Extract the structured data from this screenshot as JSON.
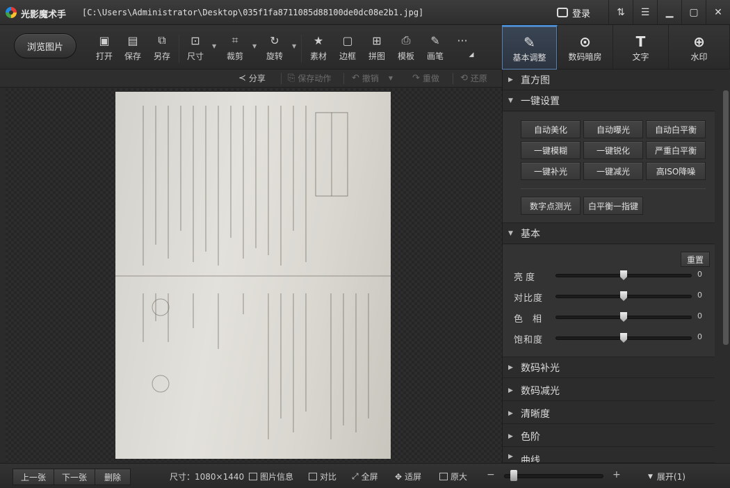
{
  "titlebar": {
    "app_name": "光影魔术手",
    "file_path": "[C:\\Users\\Administrator\\Desktop\\035f1fa8711085d88100de0dc08e2b1.jpg]",
    "login_label": "登录",
    "icons": [
      "user-icon",
      "transfer-icon",
      "menu-icon",
      "maximize-icon",
      "close-icon"
    ]
  },
  "toolbar": {
    "browse_label": "浏览图片",
    "tools": [
      {
        "key": "open",
        "label": "打开",
        "icon": "open-icon"
      },
      {
        "key": "save",
        "label": "保存",
        "icon": "save-icon"
      },
      {
        "key": "saveas",
        "label": "另存",
        "icon": "save-as-icon"
      },
      {
        "key": "size",
        "label": "尺寸",
        "icon": "size-icon"
      },
      {
        "key": "crop",
        "label": "裁剪",
        "icon": "crop-icon"
      },
      {
        "key": "rotate",
        "label": "旋转",
        "icon": "rotate-icon"
      },
      {
        "key": "material",
        "label": "素材",
        "icon": "material-icon"
      },
      {
        "key": "border",
        "label": "边框",
        "icon": "border-icon"
      },
      {
        "key": "collage",
        "label": "拼图",
        "icon": "collage-icon"
      },
      {
        "key": "template",
        "label": "模板",
        "icon": "template-icon"
      },
      {
        "key": "brush",
        "label": "画笔",
        "icon": "brush-icon"
      }
    ],
    "more_glyph": "···"
  },
  "tabs": [
    {
      "label": "基本调整",
      "icon": "basic-adjust-icon",
      "active": true
    },
    {
      "label": "数码暗房",
      "icon": "darkroom-icon",
      "active": false
    },
    {
      "label": "文字",
      "icon": "text-icon",
      "active": false
    },
    {
      "label": "水印",
      "icon": "watermark-icon",
      "active": false
    }
  ],
  "subbar": {
    "share": "分享",
    "save_action": "保存动作",
    "undo": "撤销",
    "redo": "重做",
    "restore": "还原"
  },
  "panel": {
    "histogram": "直方图",
    "one_click": {
      "title": "一键设置",
      "buttons": [
        "自动美化",
        "自动曝光",
        "自动白平衡",
        "一键模糊",
        "一键锐化",
        "严重白平衡",
        "一键补光",
        "一键减光",
        "高ISO降噪"
      ],
      "extra_buttons": [
        "数字点测光",
        "白平衡一指键"
      ]
    },
    "basic": {
      "title": "基本",
      "reset": "重置",
      "sliders": [
        {
          "label": "亮度",
          "value": "0",
          "level": 0.5
        },
        {
          "label": "对比度",
          "value": "0",
          "level": 0.5
        },
        {
          "label": "色相",
          "value": "0",
          "level": 0.5
        },
        {
          "label": "饱和度",
          "value": "0",
          "level": 0.5
        }
      ]
    },
    "collapsed_sections": [
      "数码补光",
      "数码减光",
      "清晰度",
      "色阶",
      "曲线"
    ]
  },
  "statusbar": {
    "prev": "上一张",
    "next": "下一张",
    "delete": "删除",
    "size_text": "尺寸：1080×1440",
    "image_info": "图片信息",
    "compare": "对比",
    "fullscreen": "全屏",
    "fit": "适屏",
    "original": "原大",
    "zoom_minus": "−",
    "zoom_plus": "+",
    "zoom_level": 0.1,
    "expand": "展开(1)"
  },
  "photo_text": {
    "header_items": [
      "姓名",
      "考场",
      "考号",
      "密封线"
    ],
    "title": "第二单元测试卷"
  }
}
